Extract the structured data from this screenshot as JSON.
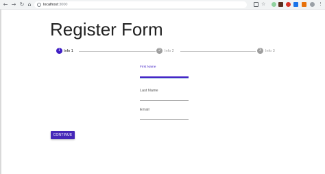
{
  "browser": {
    "url_host": "localhost",
    "url_port": ":3000"
  },
  "page": {
    "title": "Register Form"
  },
  "stepper": {
    "steps": [
      {
        "number": "1",
        "label": "Info 1",
        "active": true
      },
      {
        "number": "2",
        "label": "Info 2",
        "active": false
      },
      {
        "number": "3",
        "label": "Info 3",
        "active": false
      }
    ]
  },
  "form": {
    "first_name": {
      "label": "First Name",
      "value": ""
    },
    "last_name": {
      "label": "Last Name",
      "value": ""
    },
    "email": {
      "label": "Email",
      "value": ""
    },
    "continue_label": "CONTINUE"
  },
  "colors": {
    "accent": "#3f1ec4",
    "button": "#4527b8",
    "inactive": "#9e9e9e"
  }
}
